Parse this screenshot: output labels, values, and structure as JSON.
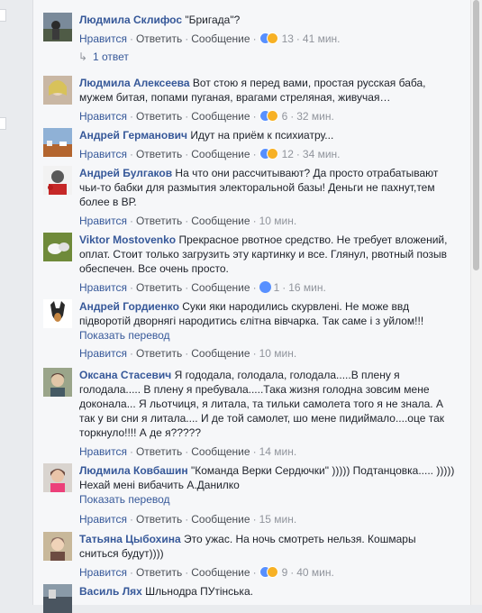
{
  "labels": {
    "like": "Нравится",
    "reply": "Ответить",
    "message": "Сообщение",
    "translate": "Показать перевод",
    "sep": "·"
  },
  "replies_link": "1 ответ",
  "comments": [
    {
      "author": "Людмила Склифос",
      "text": "\"Бригада\"?",
      "reactions": "13",
      "time": "41 мин."
    },
    {
      "author": "Людмила Алексеева",
      "text": "Вот стою я перед вами, простая русская баба, мужем битая, попами пуганая, врагами стреляная, живучая…",
      "reactions": "6",
      "time": "32 мин."
    },
    {
      "author": "Андрей Германович",
      "text": "Идут на приём к психиатру...",
      "reactions": "12",
      "time": "34 мин."
    },
    {
      "author": "Андрей Булгаков",
      "text": "На что они рассчитывают? Да просто отрабатывают чьи-то бабки для размытия электоральной базы! Деньги не пахнут,тем более в ВР.",
      "reactions": "",
      "time": "10 мин."
    },
    {
      "author": "Viktor Mostovenko",
      "text": "Прекрасное рвотное средство. Не требует вложений, оплат. Стоит только загрузить эту картинку и все. Глянул, рвотный позыв обеспечен. Все очень просто.",
      "reactions": "1",
      "time": "16 мин."
    },
    {
      "author": "Андрей Гордиенко",
      "text": "Суки яки народились скурвлені. Не може ввд підворотій дворнягі народитись єлітна вівчарка. Так саме і з уйлом!!!",
      "reactions": "",
      "time": "10 мин."
    },
    {
      "author": "Оксана Стасевич",
      "text": "Я гододала, голодала, голодала.....В плену я голодала..... В плену я пребувала.....Така жизня голодна зовсим мене доконала... Я льотчиця, я литала, та тильки самолета того я не знала. А так у ви сни я литала.... И де той самолет, шо мене пидиймало....оце так торкнуло!!!! А де я?????",
      "reactions": "",
      "time": "14 мин."
    },
    {
      "author": "Людмила Ковбашин",
      "text": "\"Команда Верки Сердючки\" ))))) Подтанцовка..... ))))) Нехай мені вибачить А.Данилко",
      "reactions": "",
      "time": "15 мин."
    },
    {
      "author": "Татьяна Цыбохина",
      "text": "Это ужас. На ночь смотреть нельзя. Кошмары сниться будут))))",
      "reactions": "9",
      "time": "40 мин."
    },
    {
      "author": "Василь Лях",
      "text": "Шльнодра ПУтінська.",
      "reactions": "",
      "time": ""
    }
  ]
}
